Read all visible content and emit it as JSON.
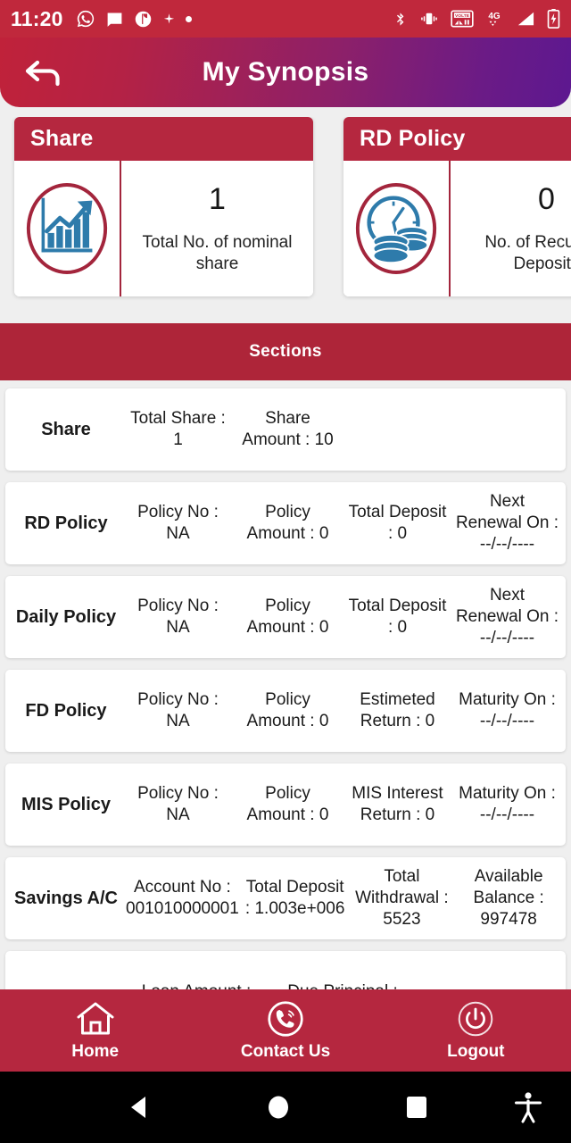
{
  "status_bar": {
    "time": "11:20",
    "left_icons": [
      "whatsapp-icon",
      "message-icon",
      "app-notification-icon",
      "sparkle-icon",
      "dot-icon"
    ],
    "right_icons": [
      "bluetooth-icon",
      "vibrate-icon",
      "volte-icon",
      "4g-icon",
      "signal-icon",
      "battery-charging-icon"
    ],
    "volte_label": "VOLTE",
    "network_label": "4G",
    "background": "#c0283c"
  },
  "header": {
    "title": "My Synopsis",
    "back_icon": "back-arrow-icon",
    "gradient_start": "#c0223a",
    "gradient_end": "#5d1890"
  },
  "summary_cards": [
    {
      "title": "Share",
      "icon": "growth-chart-icon",
      "value": "1",
      "label": "Total No. of nominal share"
    },
    {
      "title": "RD Policy",
      "icon": "clock-coins-icon",
      "value": "0",
      "label": "No. of Recurring Deposits"
    }
  ],
  "sections": {
    "header": "Sections",
    "header_color": "#ae2539",
    "rows": [
      {
        "title": "Share",
        "cells": [
          "Total Share : 1",
          "Share Amount : 10"
        ]
      },
      {
        "title": "RD Policy",
        "cells": [
          "Policy No : NA",
          "Policy Amount : 0",
          "Total Deposit : 0",
          "Next Renewal On : --/--/----"
        ]
      },
      {
        "title": "Daily Policy",
        "cells": [
          "Policy No : NA",
          "Policy Amount : 0",
          "Total Deposit : 0",
          "Next Renewal On : --/--/----"
        ]
      },
      {
        "title": "FD Policy",
        "cells": [
          "Policy No : NA",
          "Policy Amount : 0",
          "Estimeted Return : 0",
          "Maturity On : --/--/----"
        ]
      },
      {
        "title": "MIS Policy",
        "cells": [
          "Policy No : NA",
          "Policy Amount : 0",
          "MIS Interest Return : 0",
          "Maturity On : --/--/----"
        ]
      },
      {
        "title": "Savings A/C",
        "cells": [
          "Account No : 001010000001",
          "Total Deposit : 1.003e+006",
          "Total Withdrawal : 5523",
          "Available Balance : 997478"
        ]
      },
      {
        "title": "",
        "cells": [
          "Loan Amount :",
          "Due Principal :"
        ]
      }
    ]
  },
  "bottom_nav": [
    {
      "label": "Home",
      "icon": "home-icon"
    },
    {
      "label": "Contact Us",
      "icon": "phone-call-icon"
    },
    {
      "label": "Logout",
      "icon": "power-icon"
    }
  ],
  "system_nav": {
    "back": "back-triangle-icon",
    "home": "home-circle-icon",
    "recents": "recents-square-icon",
    "accessibility": "accessibility-icon"
  }
}
